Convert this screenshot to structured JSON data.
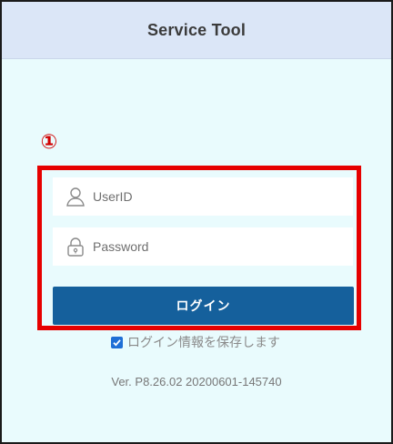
{
  "window": {
    "title": "Service Tool"
  },
  "annotation": {
    "marker": "①",
    "color": "#e60000"
  },
  "login_form": {
    "user_field": {
      "placeholder": "UserID",
      "icon": "user-icon"
    },
    "password_field": {
      "placeholder": "Password",
      "icon": "lock-icon"
    },
    "login_button_label": "ログイン",
    "remember_label": "ログイン情報を保存します",
    "remember_checked": true
  },
  "footer": {
    "version": "Ver. P8.26.02 20200601-145740"
  },
  "colors": {
    "title_bar": "#dbe6f7",
    "background": "#e9fbfd",
    "button": "#15609c"
  }
}
